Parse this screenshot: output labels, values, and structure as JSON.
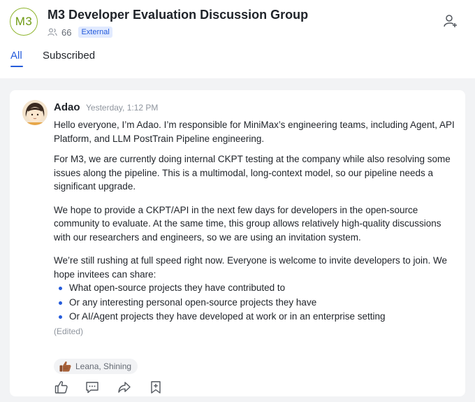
{
  "group": {
    "avatar_text": "M3",
    "title": "M3 Developer Evaluation Discussion Group",
    "member_count": "66",
    "badge": "External"
  },
  "tabs": [
    {
      "label": "All",
      "active": true
    },
    {
      "label": "Subscribed",
      "active": false
    }
  ],
  "post": {
    "author": "Adao",
    "timestamp": "Yesterday, 1:12 PM",
    "paragraphs": [
      "Hello everyone, I’m Adao. I’m responsible for MiniMax’s engineering teams, including Agent, API Platform, and LLM PostTrain Pipeline engineering.",
      "For M3, we are currently doing internal CKPT testing at the company while also resolving some issues along the pipeline. This is a multimodal, long-context model, so our pipeline needs a significant upgrade.",
      "We hope to provide a CKPT/API in the next few days for developers in the open-source community to evaluate. At the same time, this group allows relatively high-quality discussions with our researchers and engineers, so we are using an invitation system.",
      "We’re still rushing at full speed right now. Everyone is welcome to invite developers to join. We hope invitees can share:"
    ],
    "bullets": [
      "What open-source projects they have contributed to",
      "Or any interesting personal open-source projects they have",
      "Or AI/Agent projects they have developed at work or in an enterprise setting"
    ],
    "edited_label": "(Edited)",
    "reaction": {
      "emoji": "thumbs-up-icon",
      "names": "Leana, Shining"
    }
  },
  "actions": [
    "thumbs-up-icon",
    "comment-icon",
    "forward-icon",
    "bookmark-icon"
  ],
  "colors": {
    "accent": "#245bdb",
    "avatar_ring": "#8fb52e",
    "feed_bg": "#f2f3f5",
    "badge_bg": "#e1eaff"
  }
}
